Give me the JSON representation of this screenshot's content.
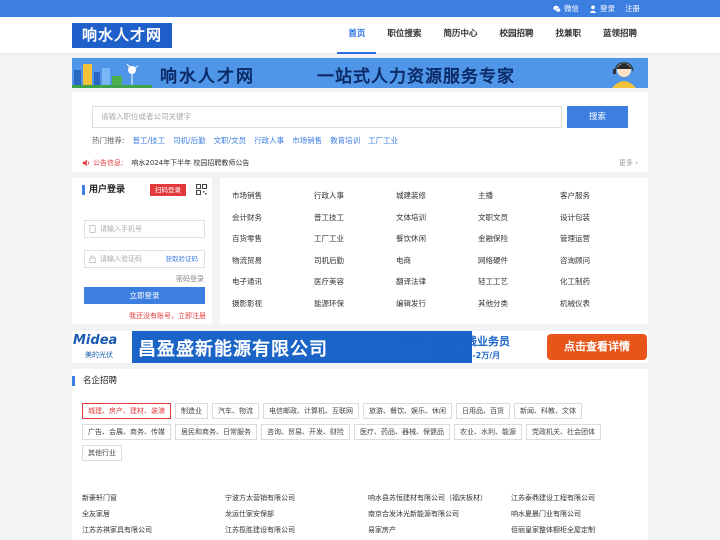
{
  "topbar": {
    "wechat": "微信",
    "login": "登录",
    "register": "注册"
  },
  "header": {
    "logo": "响水人才网",
    "nav": [
      "首页",
      "职位搜索",
      "简历中心",
      "校园招聘",
      "找兼职",
      "蓝领招聘"
    ]
  },
  "banner": {
    "title": "响水人才网",
    "slogan": "一站式人力资源服务专家"
  },
  "search": {
    "placeholder": "请输入职位或者公司关键字",
    "button": "搜索",
    "hot_label": "热门推荐:",
    "hot": [
      "普工/技工",
      "司机/后勤",
      "文职/文员",
      "行政人事",
      "市场销售",
      "教育培训",
      "工厂工业"
    ]
  },
  "notice": {
    "label": "公告信息:",
    "text": "响水2024年下半年 校园招聘教师公告",
    "more": "更多 ›"
  },
  "login": {
    "title": "用户登录",
    "scan": "扫码登录",
    "phone_placeholder": "请输入手机号",
    "code_placeholder": "请输入验证码",
    "get_code": "获取验证码",
    "password_login": "密码登录",
    "submit": "立即登录",
    "register": "我还没有账号，立即注册"
  },
  "categories": [
    "市场销售",
    "行政人事",
    "城建装修",
    "主播",
    "客户服务",
    "会计财务",
    "普工技工",
    "文体培训",
    "文职文员",
    "设计包装",
    "百货零售",
    "工厂工业",
    "餐饮休闲",
    "金融保险",
    "管理运营",
    "物流贸易",
    "司机后勤",
    "电商",
    "网络硬件",
    "咨询顾问",
    "电子通讯",
    "医疗美容",
    "翻译法律",
    "轻工工艺",
    "化工制药",
    "摄影影视",
    "能源环保",
    "编辑发行",
    "其他分类",
    "机械仪表"
  ],
  "ad": {
    "brand": "Midea",
    "brand_sub": "美的光伏",
    "company": "昌盈盛新能源有限公司",
    "job_title": "招聘：光伏一线业务员",
    "salary": "高提成  1万-2万/月",
    "cta": "点击查看详情"
  },
  "famous": {
    "title": "名企招聘",
    "tags": [
      "城建、房产、建材、装潢",
      "制造业",
      "汽车、物流",
      "电信邮政、计算机、互联网",
      "旅游、餐饮、娱乐、休闲",
      "日用品、百货",
      "新闻、科教、文体",
      "广告、会展、商务、传媒",
      "居民和商务、日常服务",
      "咨询、贸易、开发、财险",
      "医疗、药品、器械、保健品",
      "农业、水利、能源",
      "党政机关、社会团体",
      "其他行业"
    ],
    "companies": [
      "新豪轩门窗",
      "宁波方太营销有限公司",
      "响水县苏恒建材有限公司（福庆板材）",
      "江苏泰鼎建设工程有限公司",
      "全友家居",
      "龙运仕家安保部",
      "南京合发沐光新能源有限公司",
      "响水夏晨门业有限公司",
      "江苏苏祺家具有限公司",
      "江苏揽胜建设有限公司",
      "易家房产",
      "佰丽皇家整体橱柜全屋定制"
    ]
  },
  "colors": {
    "primary": "#3d7fe0",
    "logo_bg": "#1f5fc9",
    "accent_red": "#e4393c"
  }
}
